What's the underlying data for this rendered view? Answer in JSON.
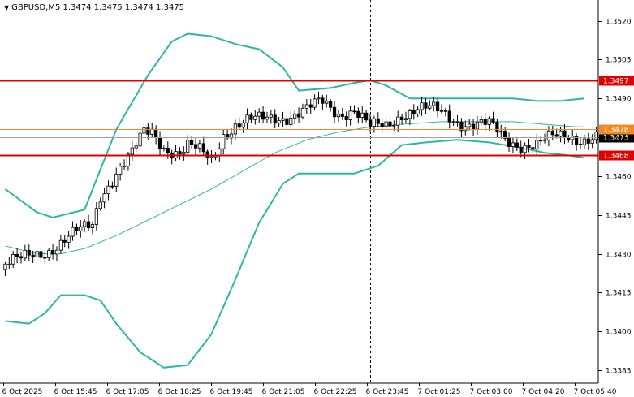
{
  "header": {
    "symbol_timeframe": "GBPUSD,M5",
    "ohlc": "1.3474 1.3475 1.3474 1.3475",
    "collapse_glyph": "▼"
  },
  "colors": {
    "background": "#ffffff",
    "axis": "#000000",
    "grid": "#c8c8c8",
    "candle": "#000000",
    "bollinger": "#2db5a8",
    "level_red": "#e00000",
    "level_orange": "#f08a24",
    "current_price_line": "#a0a0a0",
    "current_price_label_bg": "#000000"
  },
  "chart_data": {
    "type": "candlestick",
    "symbol": "GBPUSD",
    "timeframe": "M5",
    "ylim": [
      1.338,
      1.3528
    ],
    "y_ticks": [
      "1.3520",
      "1.3505",
      "1.3490",
      "1.3475",
      "1.3460",
      "1.3445",
      "1.3430",
      "1.3415",
      "1.3400",
      "1.3385"
    ],
    "x_ticks": [
      "6 Oct 2025",
      "6 Oct 15:45",
      "6 Oct 17:05",
      "6 Oct 18:25",
      "6 Oct 19:45",
      "6 Oct 21:05",
      "6 Oct 22:25",
      "6 Oct 23:45",
      "7 Oct 01:25",
      "7 Oct 03:00",
      "7 Oct 04:20",
      "7 Oct 05:40"
    ],
    "bar_count": 150,
    "levels": [
      {
        "price": 1.3497,
        "label": "1.3497",
        "color": "#e00000"
      },
      {
        "price": 1.3478,
        "label": "1.3478",
        "color": "#f08a24"
      },
      {
        "price": 1.3468,
        "label": "1.3468",
        "color": "#e00000"
      }
    ],
    "current_price": {
      "price": 1.3475,
      "label": "1.3475"
    },
    "separator_bar": 92,
    "close_anchors": [
      [
        0,
        1.3426
      ],
      [
        4,
        1.3427
      ],
      [
        8,
        1.343
      ],
      [
        12,
        1.3433
      ],
      [
        16,
        1.3436
      ],
      [
        20,
        1.3439
      ],
      [
        22,
        1.3441
      ],
      [
        24,
        1.3453
      ],
      [
        28,
        1.3462
      ],
      [
        32,
        1.3468
      ],
      [
        35,
        1.3476
      ],
      [
        37,
        1.3477
      ],
      [
        40,
        1.3472
      ],
      [
        44,
        1.3469
      ],
      [
        46,
        1.3471
      ],
      [
        50,
        1.3468
      ],
      [
        52,
        1.3466
      ],
      [
        55,
        1.3477
      ],
      [
        58,
        1.348
      ],
      [
        64,
        1.3481
      ],
      [
        68,
        1.3483
      ],
      [
        72,
        1.3484
      ],
      [
        76,
        1.3485
      ],
      [
        80,
        1.3488
      ],
      [
        84,
        1.3485
      ],
      [
        88,
        1.3486
      ],
      [
        92,
        1.3478
      ],
      [
        96,
        1.3479
      ],
      [
        100,
        1.3485
      ],
      [
        104,
        1.3486
      ],
      [
        110,
        1.3484
      ],
      [
        116,
        1.3481
      ],
      [
        122,
        1.3479
      ],
      [
        126,
        1.3474
      ],
      [
        130,
        1.3473
      ],
      [
        134,
        1.3472
      ],
      [
        138,
        1.3474
      ],
      [
        142,
        1.3476
      ],
      [
        146,
        1.3475
      ],
      [
        149,
        1.3475
      ]
    ],
    "bollinger_upper": [
      [
        0,
        1.3455
      ],
      [
        8,
        1.3446
      ],
      [
        12,
        1.3444
      ],
      [
        20,
        1.3447
      ],
      [
        28,
        1.3478
      ],
      [
        36,
        1.3499
      ],
      [
        42,
        1.3512
      ],
      [
        46,
        1.3515
      ],
      [
        52,
        1.3514
      ],
      [
        58,
        1.3511
      ],
      [
        64,
        1.3509
      ],
      [
        70,
        1.3502
      ],
      [
        74,
        1.3493
      ],
      [
        82,
        1.3494
      ],
      [
        88,
        1.3496
      ],
      [
        92,
        1.3497
      ],
      [
        96,
        1.3495
      ],
      [
        102,
        1.349
      ],
      [
        110,
        1.349
      ],
      [
        120,
        1.349
      ],
      [
        128,
        1.349
      ],
      [
        134,
        1.3489
      ],
      [
        140,
        1.3489
      ],
      [
        146,
        1.349
      ]
    ],
    "bollinger_middle": [
      [
        0,
        1.3433
      ],
      [
        8,
        1.343
      ],
      [
        14,
        1.343
      ],
      [
        20,
        1.3432
      ],
      [
        28,
        1.3437
      ],
      [
        36,
        1.3443
      ],
      [
        44,
        1.3449
      ],
      [
        52,
        1.3455
      ],
      [
        60,
        1.3462
      ],
      [
        68,
        1.3469
      ],
      [
        76,
        1.3474
      ],
      [
        84,
        1.3477
      ],
      [
        92,
        1.3479
      ],
      [
        100,
        1.348
      ],
      [
        110,
        1.3481
      ],
      [
        120,
        1.3481
      ],
      [
        128,
        1.3481
      ],
      [
        136,
        1.348
      ],
      [
        144,
        1.3479
      ],
      [
        146,
        1.3479
      ]
    ],
    "bollinger_lower": [
      [
        0,
        1.3404
      ],
      [
        6,
        1.3403
      ],
      [
        10,
        1.3407
      ],
      [
        14,
        1.3414
      ],
      [
        20,
        1.3414
      ],
      [
        24,
        1.3412
      ],
      [
        28,
        1.3403
      ],
      [
        34,
        1.3392
      ],
      [
        40,
        1.3386
      ],
      [
        46,
        1.3387
      ],
      [
        52,
        1.3399
      ],
      [
        58,
        1.342
      ],
      [
        64,
        1.3442
      ],
      [
        70,
        1.3457
      ],
      [
        74,
        1.3461
      ],
      [
        80,
        1.3461
      ],
      [
        88,
        1.3461
      ],
      [
        94,
        1.3464
      ],
      [
        100,
        1.3472
      ],
      [
        106,
        1.3473
      ],
      [
        114,
        1.3474
      ],
      [
        122,
        1.3473
      ],
      [
        130,
        1.3471
      ],
      [
        136,
        1.3469
      ],
      [
        142,
        1.3468
      ],
      [
        146,
        1.3467
      ]
    ]
  }
}
